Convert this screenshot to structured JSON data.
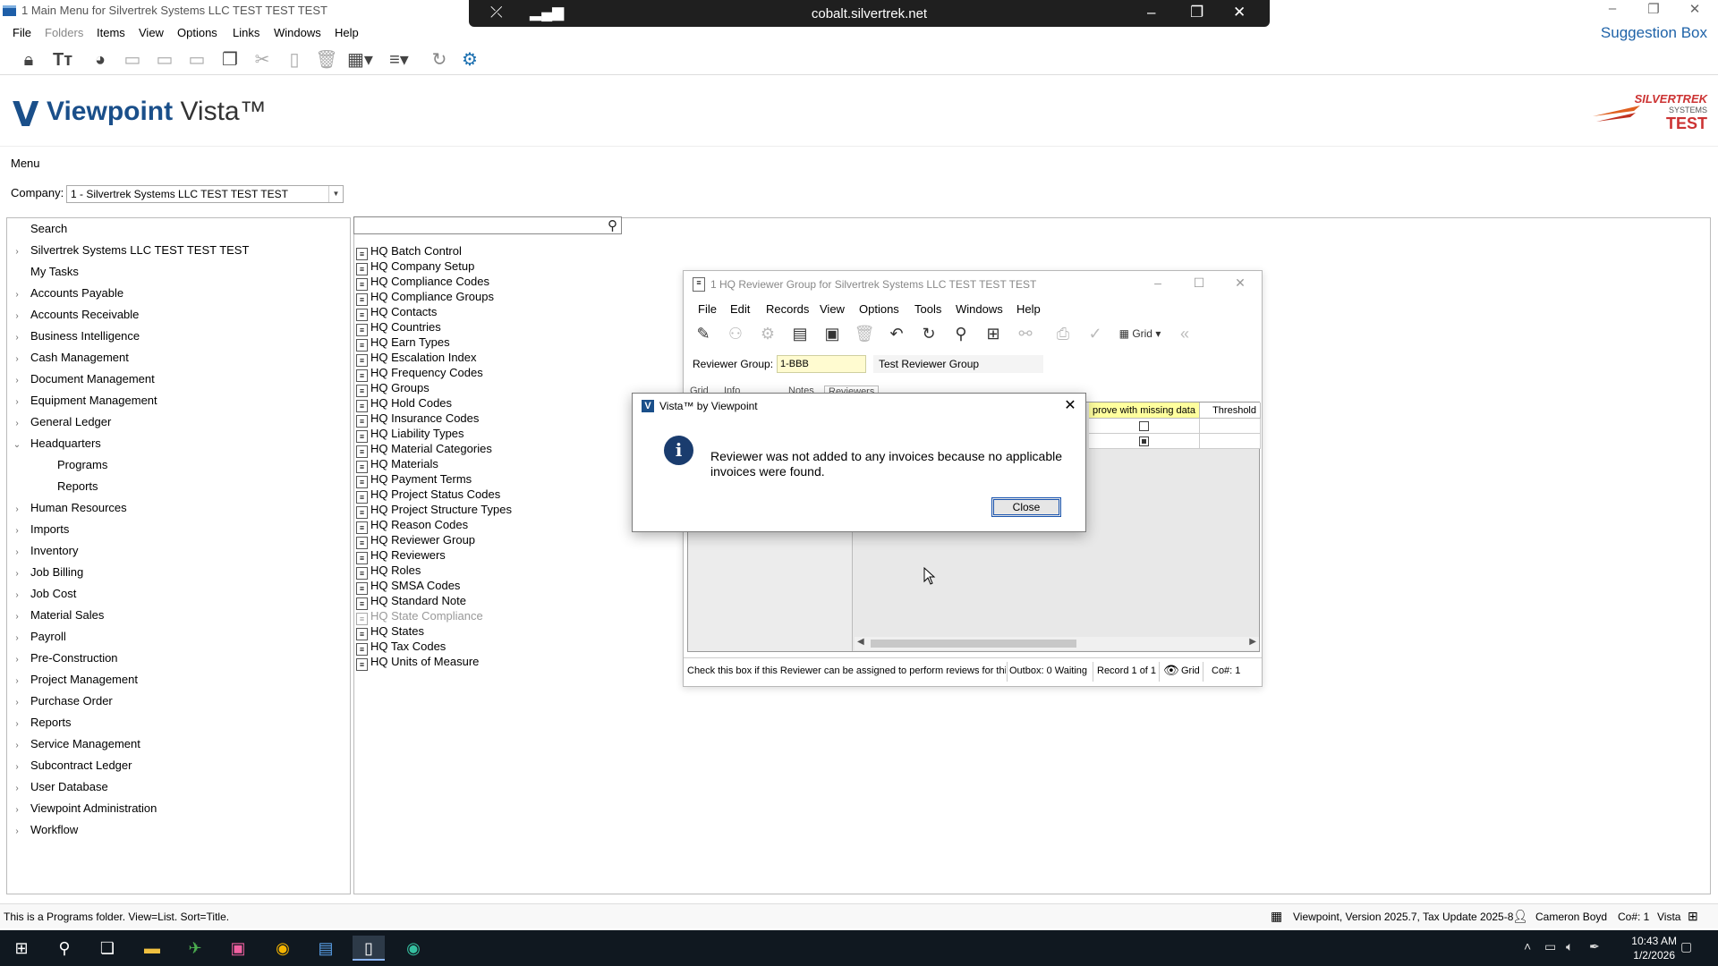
{
  "window": {
    "title": "1 Main Menu for Silvertrek Systems LLC TEST TEST TEST",
    "minimize": "–",
    "restore": "❐",
    "close": "✕"
  },
  "rdp": {
    "host": "cobalt.silvertrek.net",
    "minimize": "–",
    "restore": "❐",
    "close": "✕"
  },
  "menubar": {
    "items": [
      "File",
      "Folders",
      "Items",
      "View",
      "Options",
      "Links",
      "Windows",
      "Help"
    ],
    "suggestion_box": "Suggestion Box"
  },
  "toolbar": {
    "icons": [
      "lock-icon",
      "font-size-icon",
      "palette-icon",
      "new-folder-icon",
      "rename-folder-icon",
      "folder-icon",
      "copy-icon",
      "cut-icon",
      "paste-icon",
      "delete-icon",
      "grid-view-icon",
      "sort-icon",
      "refresh-icon",
      "viewpoint-icon"
    ]
  },
  "header": {
    "logo_v": "V",
    "logo_bold": "Viewpoint",
    "logo_rest": " Vista™",
    "brand_line1": "SILVERTREK",
    "brand_line2": "SYSTEMS",
    "brand_line3": "TEST"
  },
  "menu_label": "Menu",
  "company": {
    "label": "Company:",
    "value": "1 - Silvertrek Systems LLC TEST TEST TEST"
  },
  "tree": {
    "items": [
      {
        "label": "Search",
        "expander": "",
        "indent": 0
      },
      {
        "label": "Silvertrek Systems LLC TEST TEST TEST",
        "expander": "›",
        "indent": 0
      },
      {
        "label": "My Tasks",
        "expander": "",
        "indent": 0
      },
      {
        "label": "Accounts Payable",
        "expander": "›",
        "indent": 0
      },
      {
        "label": "Accounts Receivable",
        "expander": "›",
        "indent": 0
      },
      {
        "label": "Business Intelligence",
        "expander": "›",
        "indent": 0
      },
      {
        "label": "Cash Management",
        "expander": "›",
        "indent": 0
      },
      {
        "label": "Document Management",
        "expander": "›",
        "indent": 0
      },
      {
        "label": "Equipment Management",
        "expander": "›",
        "indent": 0
      },
      {
        "label": "General Ledger",
        "expander": "›",
        "indent": 0
      },
      {
        "label": "Headquarters",
        "expander": "⌄",
        "indent": 0
      },
      {
        "label": "Programs",
        "expander": "",
        "indent": 1
      },
      {
        "label": "Reports",
        "expander": "",
        "indent": 1
      },
      {
        "label": "Human Resources",
        "expander": "›",
        "indent": 0
      },
      {
        "label": "Imports",
        "expander": "›",
        "indent": 0
      },
      {
        "label": "Inventory",
        "expander": "›",
        "indent": 0
      },
      {
        "label": "Job Billing",
        "expander": "›",
        "indent": 0
      },
      {
        "label": "Job Cost",
        "expander": "›",
        "indent": 0
      },
      {
        "label": "Material Sales",
        "expander": "›",
        "indent": 0
      },
      {
        "label": "Payroll",
        "expander": "›",
        "indent": 0
      },
      {
        "label": "Pre-Construction",
        "expander": "›",
        "indent": 0
      },
      {
        "label": "Project Management",
        "expander": "›",
        "indent": 0
      },
      {
        "label": "Purchase Order",
        "expander": "›",
        "indent": 0
      },
      {
        "label": "Reports",
        "expander": "›",
        "indent": 0
      },
      {
        "label": "Service Management",
        "expander": "›",
        "indent": 0
      },
      {
        "label": "Subcontract Ledger",
        "expander": "›",
        "indent": 0
      },
      {
        "label": "User Database",
        "expander": "›",
        "indent": 0
      },
      {
        "label": "Viewpoint Administration",
        "expander": "›",
        "indent": 0
      },
      {
        "label": "Workflow",
        "expander": "›",
        "indent": 0
      }
    ]
  },
  "programs": {
    "items": [
      {
        "label": "HQ Batch Control",
        "disabled": false
      },
      {
        "label": "HQ Company Setup",
        "disabled": false
      },
      {
        "label": "HQ Compliance Codes",
        "disabled": false
      },
      {
        "label": "HQ Compliance Groups",
        "disabled": false
      },
      {
        "label": "HQ Contacts",
        "disabled": false
      },
      {
        "label": "HQ Countries",
        "disabled": false
      },
      {
        "label": "HQ Earn Types",
        "disabled": false
      },
      {
        "label": "HQ Escalation Index",
        "disabled": false
      },
      {
        "label": "HQ Frequency Codes",
        "disabled": false
      },
      {
        "label": "HQ Groups",
        "disabled": false
      },
      {
        "label": "HQ Hold Codes",
        "disabled": false
      },
      {
        "label": "HQ Insurance Codes",
        "disabled": false
      },
      {
        "label": "HQ Liability Types",
        "disabled": false
      },
      {
        "label": "HQ Material Categories",
        "disabled": false
      },
      {
        "label": "HQ Materials",
        "disabled": false
      },
      {
        "label": "HQ Payment Terms",
        "disabled": false
      },
      {
        "label": "HQ Project Status Codes",
        "disabled": false
      },
      {
        "label": "HQ Project Structure Types",
        "disabled": false
      },
      {
        "label": "HQ Reason Codes",
        "disabled": false
      },
      {
        "label": "HQ Reviewer Group",
        "disabled": false
      },
      {
        "label": "HQ Reviewers",
        "disabled": false
      },
      {
        "label": "HQ Roles",
        "disabled": false
      },
      {
        "label": "HQ SMSA Codes",
        "disabled": false
      },
      {
        "label": "HQ Standard Note",
        "disabled": false
      },
      {
        "label": "HQ State Compliance",
        "disabled": true
      },
      {
        "label": "HQ States",
        "disabled": false
      },
      {
        "label": "HQ Tax Codes",
        "disabled": false
      },
      {
        "label": "HQ Units of Measure",
        "disabled": false
      }
    ]
  },
  "hq_window": {
    "title": "1 HQ Reviewer Group for Silvertrek Systems LLC TEST TEST TEST",
    "menu": [
      "File",
      "Edit",
      "Records",
      "View",
      "Options",
      "Tools",
      "Windows",
      "Help"
    ],
    "grid_label": "Grid",
    "reviewer_group_label": "Reviewer Group:",
    "reviewer_group_value": "1-BBB",
    "reviewer_group_desc": "Test Reviewer Group",
    "tabs": [
      "Grid",
      "Info",
      "Notes",
      "Reviewers"
    ],
    "col_approve": "prove with missing data",
    "col_threshold": "Threshold",
    "row_checks": [
      false,
      true
    ],
    "status": {
      "hint": "Check this box if this Reviewer can be assigned to perform reviews for thi",
      "outbox": "Outbox: 0 Waiting",
      "record": "Record 1 of 1",
      "view": "Grid",
      "co": "Co#: 1"
    }
  },
  "dialog": {
    "title": "Vista™ by Viewpoint",
    "message": "Reviewer was not added to any invoices because no applicable invoices were found.",
    "close_label": "Close"
  },
  "statusbar": {
    "left": "This is a Programs folder. View=List. Sort=Title.",
    "version": "Viewpoint, Version 2025.7, Tax Update 2025-8",
    "user": "Cameron Boyd",
    "co": "Co#: 1",
    "app": "Vista"
  },
  "taskbar": {
    "time": "10:43 AM",
    "date": "1/2/2026"
  }
}
